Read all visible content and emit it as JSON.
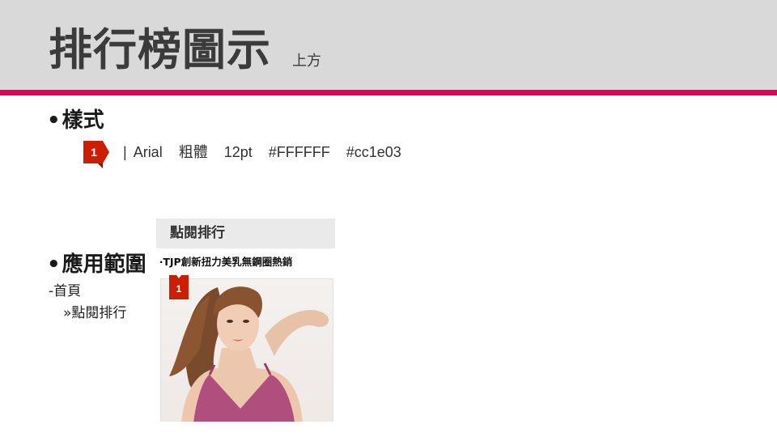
{
  "header": {
    "title": "排行榜圖示",
    "subtitle": "上方"
  },
  "style_section": {
    "bullet": "•",
    "label": "樣式",
    "badge_number": "1",
    "separator": "|",
    "font": "Arial",
    "weight": "粗體",
    "size": "12pt",
    "text_color": "#FFFFFF",
    "bg_color": "#cc1e03"
  },
  "scope_section": {
    "bullet": "•",
    "label": "應用範圍",
    "item": "-首頁",
    "sub_item": "»點閱排行"
  },
  "preview": {
    "header_label": "點閱排行",
    "product_title": "‧TJP創新扭力美乳無鋼圈熱銷",
    "badge_number": "1"
  },
  "colors": {
    "accent": "#e5005a",
    "badge": "#cc1e03",
    "header_bg": "#d9d9d9"
  }
}
